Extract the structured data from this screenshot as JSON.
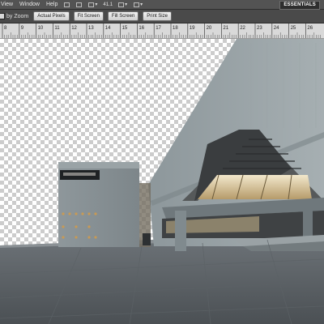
{
  "menu": {
    "items": [
      "View",
      "Window",
      "Help"
    ],
    "zoom_value": "41.1",
    "workspace": "ESSENTIALS"
  },
  "options": {
    "zoom_mode_label": "by Zoom",
    "buttons": [
      "Actual Pixels",
      "Fit Screen",
      "Fill Screen",
      "Print Size"
    ]
  },
  "ruler": {
    "labels": [
      "8",
      "9",
      "10",
      "11",
      "12",
      "13",
      "14",
      "15",
      "16",
      "17",
      "18",
      "19",
      "20",
      "21",
      "22",
      "23",
      "24",
      "25",
      "26"
    ]
  },
  "document": {
    "description_icon": "image-document"
  },
  "colors": {
    "app_bg": "#535353",
    "options_bg": "#4a4a4a",
    "ruler_bg": "#d9d9d9",
    "checker_dark": "#cccccc",
    "checker_light": "#ffffff"
  }
}
